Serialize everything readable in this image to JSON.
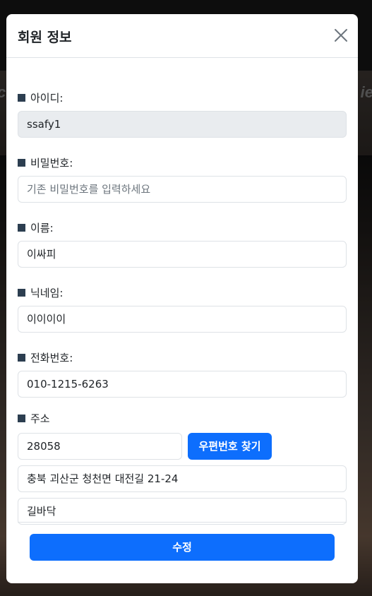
{
  "background": {
    "fragment_left": "c",
    "fragment_right": "ie"
  },
  "modal": {
    "title": "회원 정보",
    "close_icon": "close-icon",
    "fields": {
      "id": {
        "label": "아이디:",
        "value": "ssafy1",
        "disabled": true
      },
      "password": {
        "label": "비밀번호:",
        "placeholder": "기존 비밀번호를 입력하세요",
        "value": ""
      },
      "name": {
        "label": "이름:",
        "value": "이싸피"
      },
      "nickname": {
        "label": "닉네임:",
        "value": "이이이이"
      },
      "phone": {
        "label": "전화번호:",
        "value": "010-1215-6263"
      },
      "address": {
        "label": "주소",
        "zipcode": "28058",
        "find_zip_button": "우편번호 찾기",
        "address1": "충북 괴산군 청천면 대전길 21-24",
        "address2": "길바닥"
      }
    },
    "submit_button": "수정"
  },
  "colors": {
    "primary": "#0d6efd",
    "label_square": "#2c3e50",
    "disabled_bg": "#e9ecef"
  }
}
